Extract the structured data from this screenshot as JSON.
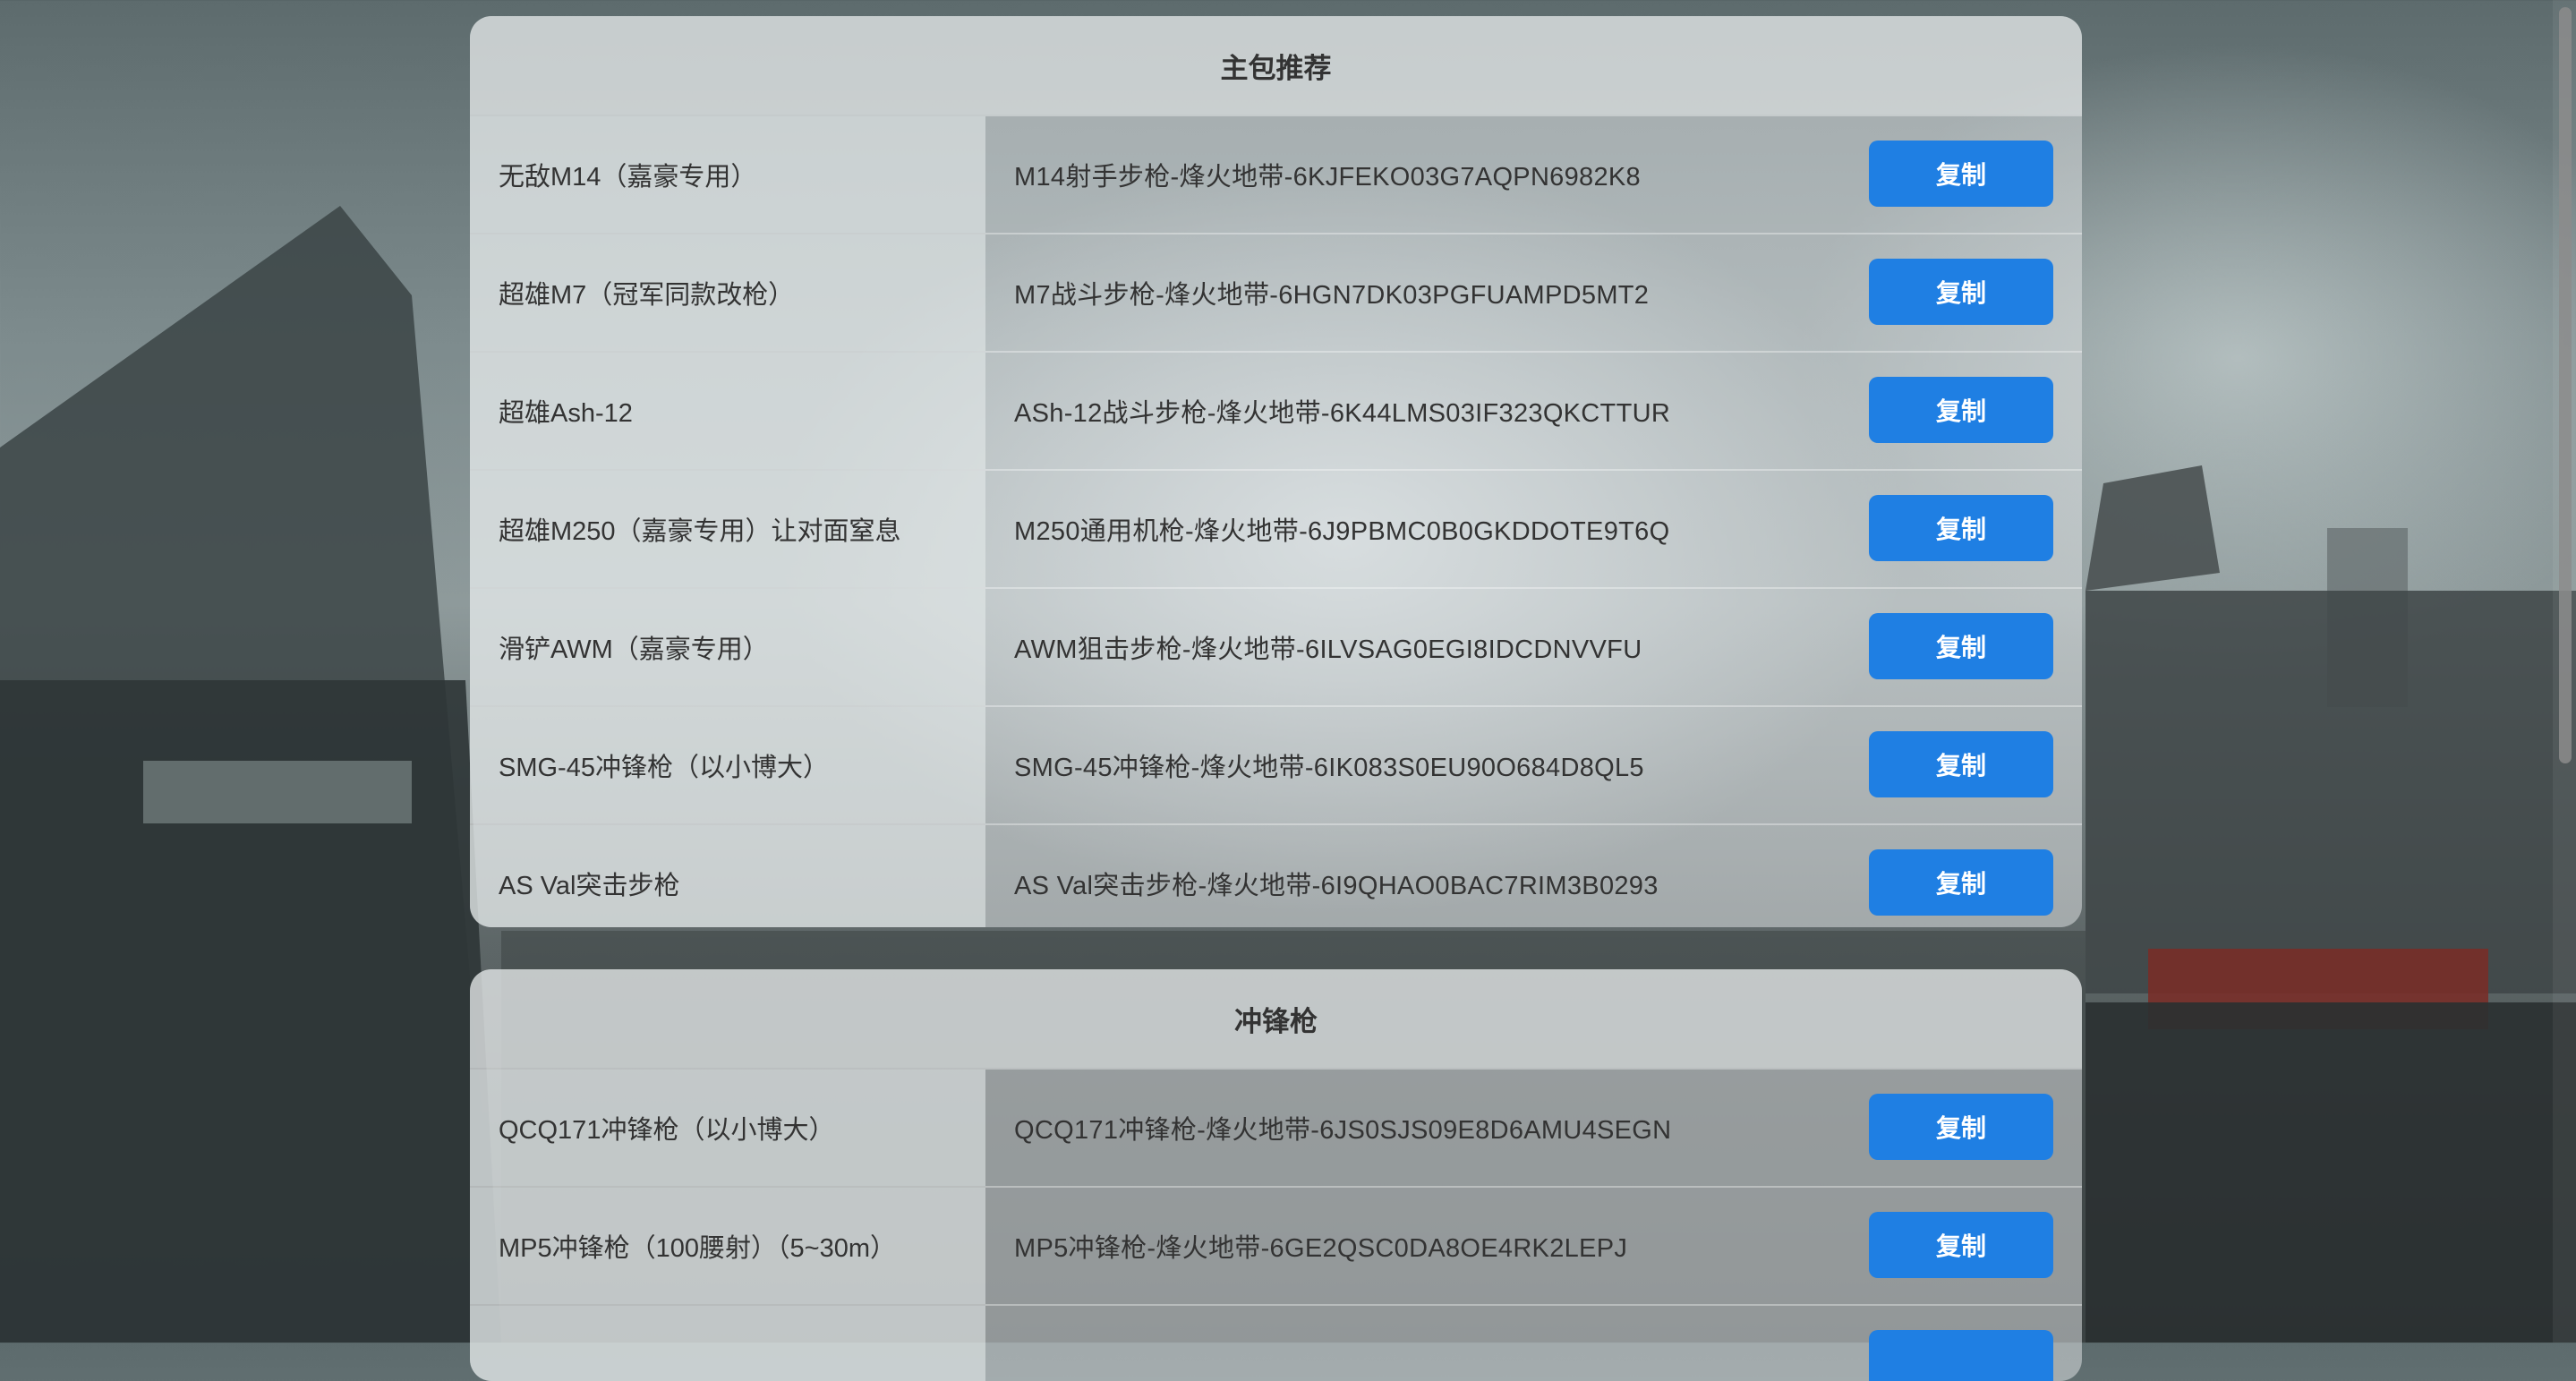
{
  "colors": {
    "accent": "#1f7fe3",
    "text": "#333333"
  },
  "sections": [
    {
      "title": "主包推荐",
      "rows": [
        {
          "name": "无敌M14（嘉豪专用）",
          "code": "M14射手步枪-烽火地带-6KJFEKO03G7AQPN6982K8",
          "button": "复制"
        },
        {
          "name": "超雄M7（冠军同款改枪）",
          "code": "M7战斗步枪-烽火地带-6HGN7DK03PGFUAMPD5MT2",
          "button": "复制"
        },
        {
          "name": "超雄Ash-12",
          "code": "ASh-12战斗步枪-烽火地带-6K44LMS03IF323QKCTTUR",
          "button": "复制"
        },
        {
          "name": "超雄M250（嘉豪专用）让对面窒息",
          "code": "M250通用机枪-烽火地带-6J9PBMC0B0GKDDOTE9T6Q",
          "button": "复制"
        },
        {
          "name": "滑铲AWM（嘉豪专用）",
          "code": "AWM狙击步枪-烽火地带-6ILVSAG0EGI8IDCDNVVFU",
          "button": "复制"
        },
        {
          "name": "SMG-45冲锋枪（以小博大）",
          "code": "SMG-45冲锋枪-烽火地带-6IK083S0EU90O684D8QL5",
          "button": "复制"
        },
        {
          "name": "AS Val突击步枪",
          "code": "AS Val突击步枪-烽火地带-6I9QHAO0BAC7RIM3B0293",
          "button": "复制"
        }
      ]
    },
    {
      "title": "冲锋枪",
      "rows": [
        {
          "name": "QCQ171冲锋枪（以小博大）",
          "code": "QCQ171冲锋枪-烽火地带-6JS0SJS09E8D6AMU4SEGN",
          "button": "复制"
        },
        {
          "name": "MP5冲锋枪（100腰射）（5~30m）",
          "code": "MP5冲锋枪-烽火地带-6GE2QSC0DA8OE4RK2LEPJ",
          "button": "复制"
        },
        {
          "name": "",
          "code": "",
          "button": ""
        }
      ]
    }
  ]
}
